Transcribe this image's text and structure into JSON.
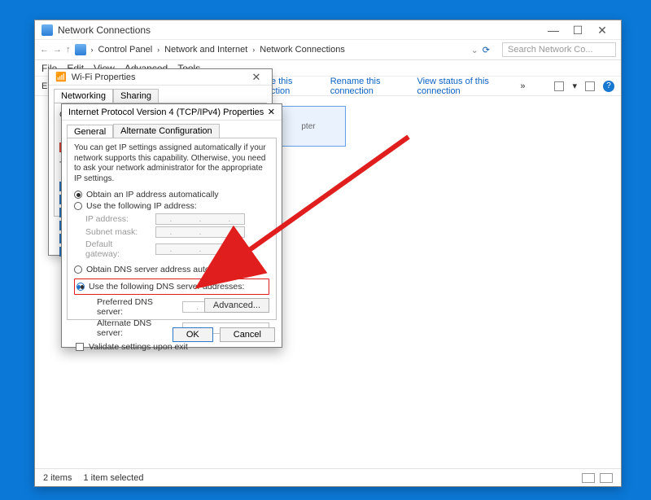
{
  "explorer": {
    "title": "Network Connections",
    "breadcrumb": [
      "Control Panel",
      "Network and Internet",
      "Network Connections"
    ],
    "search_placeholder": "Search Network Co...",
    "menubar": [
      "File",
      "Edit",
      "View",
      "Advanced",
      "Tools"
    ],
    "toolbar": {
      "left_cut": "EF",
      "diagnose": "agnose this connection",
      "rename": "Rename this connection",
      "viewstatus": "View status of this connection"
    },
    "adapter_placeholder": "pter",
    "status_left": "2 items",
    "status_sel": "1 item selected"
  },
  "wifiDialog": {
    "title": "Wi-Fi Properties",
    "tabs": {
      "networking": "Networking",
      "sharing": "Sharing"
    },
    "row_label_frag": "C---",
    "content_hint": "Th"
  },
  "ipv4": {
    "title": "Internet Protocol Version 4 (TCP/IPv4) Properties",
    "tabs": {
      "general": "General",
      "alt": "Alternate Configuration"
    },
    "desc": "You can get IP settings assigned automatically if your network supports this capability. Otherwise, you need to ask your network administrator for the appropriate IP settings.",
    "radio_ip_auto": "Obtain an IP address automatically",
    "radio_ip_manual": "Use the following IP address:",
    "ip_labels": {
      "ip": "IP address:",
      "mask": "Subnet mask:",
      "gw": "Default gateway:"
    },
    "radio_dns_auto": "Obtain DNS server address automatically",
    "radio_dns_manual": "Use the following DNS server addresses:",
    "dns_labels": {
      "pref": "Preferred DNS server:",
      "alt": "Alternate DNS server:"
    },
    "validate": "Validate settings upon exit",
    "advanced_btn": "Advanced...",
    "ok": "OK",
    "cancel": "Cancel"
  }
}
